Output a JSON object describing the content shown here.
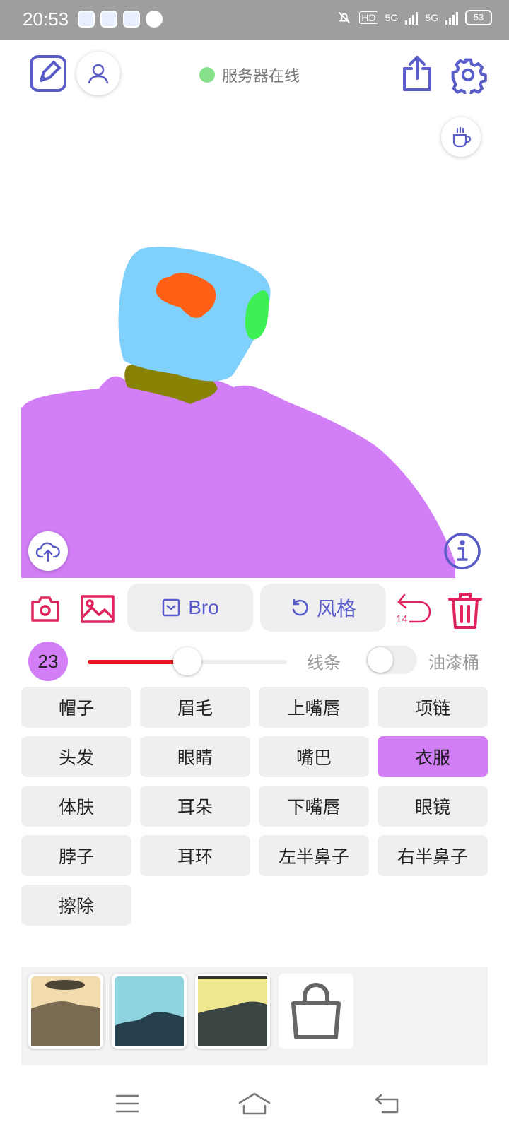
{
  "status_bar": {
    "time": "20:53",
    "hd": "HD",
    "net1": "5G",
    "net2": "5G",
    "battery": "53"
  },
  "header": {
    "server_status": "服务器在线",
    "server_status_color": "#86e08a",
    "accent_color": "#5a5cc8"
  },
  "icons": {
    "edit": "edit-icon",
    "user": "user-icon",
    "share": "share-icon",
    "settings": "gear-icon",
    "coffee": "coffee-icon",
    "upload": "cloud-upload-icon",
    "info": "info-icon",
    "camera": "camera-icon",
    "image": "image-icon",
    "undo": "undo-icon",
    "trash": "trash-icon"
  },
  "toolbar": {
    "bro_label": "Bro",
    "style_label": "风格",
    "undo_count": "14"
  },
  "brush": {
    "size": "23",
    "slider_fraction": 0.5,
    "slider_fill_color": "#e8141e",
    "lines_label": "线条",
    "bucket_label": "油漆桶",
    "bucket_enabled": false
  },
  "parts": [
    {
      "label": "帽子",
      "active": false
    },
    {
      "label": "眉毛",
      "active": false
    },
    {
      "label": "上嘴唇",
      "active": false
    },
    {
      "label": "项链",
      "active": false
    },
    {
      "label": "头发",
      "active": false
    },
    {
      "label": "眼睛",
      "active": false
    },
    {
      "label": "嘴巴",
      "active": false
    },
    {
      "label": "衣服",
      "active": true
    },
    {
      "label": "体肤",
      "active": false
    },
    {
      "label": "耳朵",
      "active": false
    },
    {
      "label": "下嘴唇",
      "active": false
    },
    {
      "label": "眼镜",
      "active": false
    },
    {
      "label": "脖子",
      "active": false
    },
    {
      "label": "耳环",
      "active": false
    },
    {
      "label": "左半鼻子",
      "active": false
    },
    {
      "label": "右半鼻子",
      "active": false
    },
    {
      "label": "擦除",
      "active": false
    }
  ],
  "active_part_color": "#d27ff7",
  "drawing_colors": {
    "clothes": "#d27ff7",
    "skin": "#7fd0fb",
    "neck": "#888205",
    "eye": "#ff6016",
    "ear": "#3df055"
  },
  "presets": [
    {
      "name": "preset-1",
      "colors": [
        "#f2dcae",
        "#7a6a52"
      ]
    },
    {
      "name": "preset-2",
      "colors": [
        "#8fd3de",
        "#27404e"
      ]
    },
    {
      "name": "preset-3",
      "colors": [
        "#efe690",
        "#3b4544"
      ]
    },
    {
      "name": "preset-shop",
      "icon": "shopping-bag-icon"
    }
  ],
  "nav": {
    "menu": "menu-icon",
    "home": "home-icon",
    "back": "back-icon"
  }
}
